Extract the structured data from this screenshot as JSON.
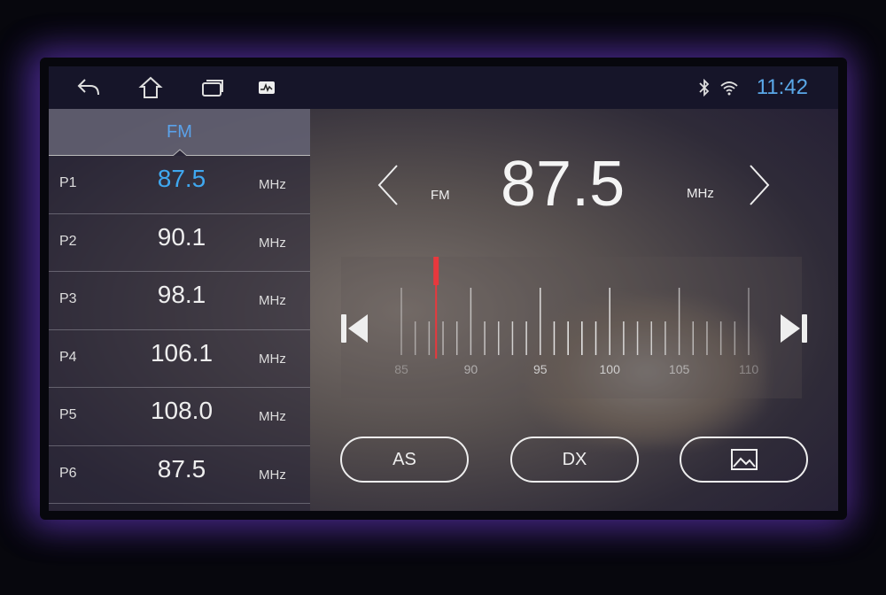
{
  "statusbar": {
    "time": "11:42",
    "icons": [
      "back-icon",
      "home-icon",
      "recent-apps-icon",
      "activity-icon",
      "bluetooth-icon",
      "wifi-icon"
    ]
  },
  "presets": {
    "band": "FM",
    "items": [
      {
        "label": "P1",
        "freq": "87.5",
        "unit": "MHz",
        "active": true
      },
      {
        "label": "P2",
        "freq": "90.1",
        "unit": "MHz"
      },
      {
        "label": "P3",
        "freq": "98.1",
        "unit": "MHz"
      },
      {
        "label": "P4",
        "freq": "106.1",
        "unit": "MHz"
      },
      {
        "label": "P5",
        "freq": "108.0",
        "unit": "MHz"
      },
      {
        "label": "P6",
        "freq": "87.5",
        "unit": "MHz"
      }
    ]
  },
  "tuner": {
    "band": "FM",
    "freq": "87.5",
    "unit": "MHz",
    "current": 87.5,
    "min": 85,
    "max": 110,
    "scale_labels": [
      "85",
      "90",
      "95",
      "100",
      "105",
      "110"
    ],
    "needle_color": "#e8383d"
  },
  "buttons": {
    "as": "AS",
    "dx": "DX",
    "background_icon": "image-icon"
  }
}
